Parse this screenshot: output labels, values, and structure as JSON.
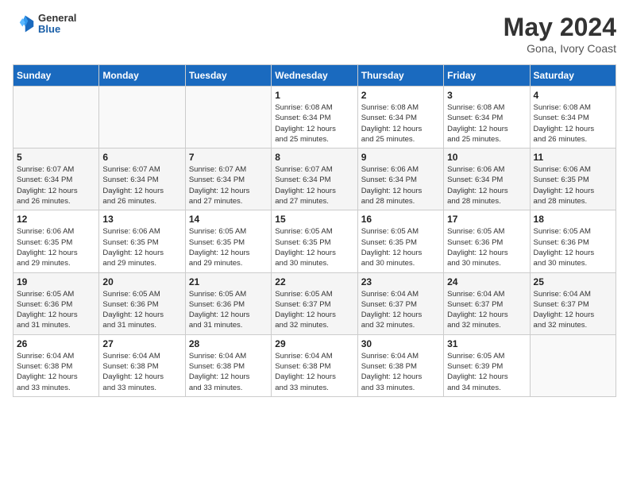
{
  "header": {
    "logo_line1": "General",
    "logo_line2": "Blue",
    "month_year": "May 2024",
    "location": "Gona, Ivory Coast"
  },
  "weekdays": [
    "Sunday",
    "Monday",
    "Tuesday",
    "Wednesday",
    "Thursday",
    "Friday",
    "Saturday"
  ],
  "weeks": [
    [
      {
        "day": "",
        "info": ""
      },
      {
        "day": "",
        "info": ""
      },
      {
        "day": "",
        "info": ""
      },
      {
        "day": "1",
        "info": "Sunrise: 6:08 AM\nSunset: 6:34 PM\nDaylight: 12 hours\nand 25 minutes."
      },
      {
        "day": "2",
        "info": "Sunrise: 6:08 AM\nSunset: 6:34 PM\nDaylight: 12 hours\nand 25 minutes."
      },
      {
        "day": "3",
        "info": "Sunrise: 6:08 AM\nSunset: 6:34 PM\nDaylight: 12 hours\nand 25 minutes."
      },
      {
        "day": "4",
        "info": "Sunrise: 6:08 AM\nSunset: 6:34 PM\nDaylight: 12 hours\nand 26 minutes."
      }
    ],
    [
      {
        "day": "5",
        "info": "Sunrise: 6:07 AM\nSunset: 6:34 PM\nDaylight: 12 hours\nand 26 minutes."
      },
      {
        "day": "6",
        "info": "Sunrise: 6:07 AM\nSunset: 6:34 PM\nDaylight: 12 hours\nand 26 minutes."
      },
      {
        "day": "7",
        "info": "Sunrise: 6:07 AM\nSunset: 6:34 PM\nDaylight: 12 hours\nand 27 minutes."
      },
      {
        "day": "8",
        "info": "Sunrise: 6:07 AM\nSunset: 6:34 PM\nDaylight: 12 hours\nand 27 minutes."
      },
      {
        "day": "9",
        "info": "Sunrise: 6:06 AM\nSunset: 6:34 PM\nDaylight: 12 hours\nand 28 minutes."
      },
      {
        "day": "10",
        "info": "Sunrise: 6:06 AM\nSunset: 6:34 PM\nDaylight: 12 hours\nand 28 minutes."
      },
      {
        "day": "11",
        "info": "Sunrise: 6:06 AM\nSunset: 6:35 PM\nDaylight: 12 hours\nand 28 minutes."
      }
    ],
    [
      {
        "day": "12",
        "info": "Sunrise: 6:06 AM\nSunset: 6:35 PM\nDaylight: 12 hours\nand 29 minutes."
      },
      {
        "day": "13",
        "info": "Sunrise: 6:06 AM\nSunset: 6:35 PM\nDaylight: 12 hours\nand 29 minutes."
      },
      {
        "day": "14",
        "info": "Sunrise: 6:05 AM\nSunset: 6:35 PM\nDaylight: 12 hours\nand 29 minutes."
      },
      {
        "day": "15",
        "info": "Sunrise: 6:05 AM\nSunset: 6:35 PM\nDaylight: 12 hours\nand 30 minutes."
      },
      {
        "day": "16",
        "info": "Sunrise: 6:05 AM\nSunset: 6:35 PM\nDaylight: 12 hours\nand 30 minutes."
      },
      {
        "day": "17",
        "info": "Sunrise: 6:05 AM\nSunset: 6:36 PM\nDaylight: 12 hours\nand 30 minutes."
      },
      {
        "day": "18",
        "info": "Sunrise: 6:05 AM\nSunset: 6:36 PM\nDaylight: 12 hours\nand 30 minutes."
      }
    ],
    [
      {
        "day": "19",
        "info": "Sunrise: 6:05 AM\nSunset: 6:36 PM\nDaylight: 12 hours\nand 31 minutes."
      },
      {
        "day": "20",
        "info": "Sunrise: 6:05 AM\nSunset: 6:36 PM\nDaylight: 12 hours\nand 31 minutes."
      },
      {
        "day": "21",
        "info": "Sunrise: 6:05 AM\nSunset: 6:36 PM\nDaylight: 12 hours\nand 31 minutes."
      },
      {
        "day": "22",
        "info": "Sunrise: 6:05 AM\nSunset: 6:37 PM\nDaylight: 12 hours\nand 32 minutes."
      },
      {
        "day": "23",
        "info": "Sunrise: 6:04 AM\nSunset: 6:37 PM\nDaylight: 12 hours\nand 32 minutes."
      },
      {
        "day": "24",
        "info": "Sunrise: 6:04 AM\nSunset: 6:37 PM\nDaylight: 12 hours\nand 32 minutes."
      },
      {
        "day": "25",
        "info": "Sunrise: 6:04 AM\nSunset: 6:37 PM\nDaylight: 12 hours\nand 32 minutes."
      }
    ],
    [
      {
        "day": "26",
        "info": "Sunrise: 6:04 AM\nSunset: 6:38 PM\nDaylight: 12 hours\nand 33 minutes."
      },
      {
        "day": "27",
        "info": "Sunrise: 6:04 AM\nSunset: 6:38 PM\nDaylight: 12 hours\nand 33 minutes."
      },
      {
        "day": "28",
        "info": "Sunrise: 6:04 AM\nSunset: 6:38 PM\nDaylight: 12 hours\nand 33 minutes."
      },
      {
        "day": "29",
        "info": "Sunrise: 6:04 AM\nSunset: 6:38 PM\nDaylight: 12 hours\nand 33 minutes."
      },
      {
        "day": "30",
        "info": "Sunrise: 6:04 AM\nSunset: 6:38 PM\nDaylight: 12 hours\nand 33 minutes."
      },
      {
        "day": "31",
        "info": "Sunrise: 6:05 AM\nSunset: 6:39 PM\nDaylight: 12 hours\nand 34 minutes."
      },
      {
        "day": "",
        "info": ""
      }
    ]
  ]
}
